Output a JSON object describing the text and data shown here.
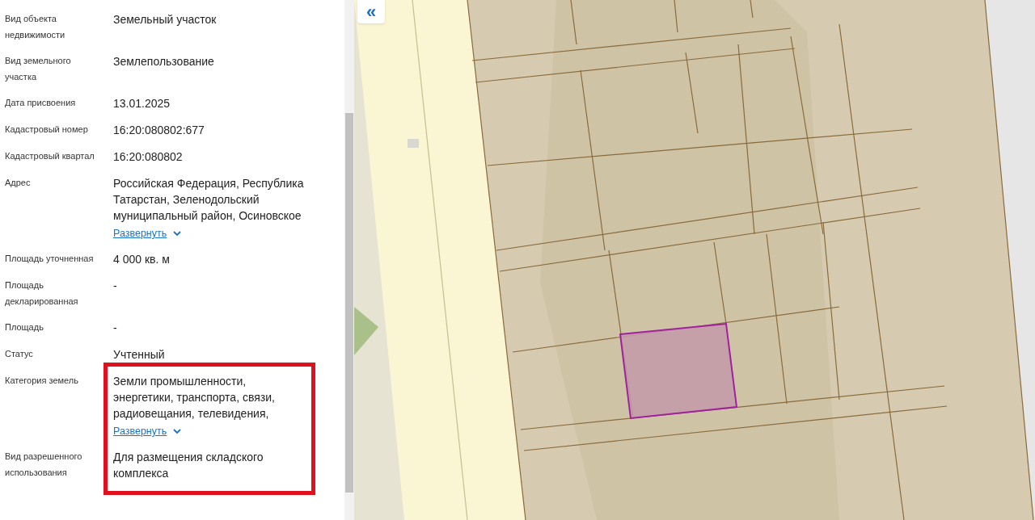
{
  "details": [
    {
      "label": "Вид объекта недвижимости",
      "value": "Земельный участок",
      "highlighted": false
    },
    {
      "label": "Вид земельного участка",
      "value": "Землепользование",
      "highlighted": false
    },
    {
      "label": "Дата присвоения",
      "value": "13.01.2025",
      "highlighted": false
    },
    {
      "label": "Кадастровый номер",
      "value": "16:20:080802:677",
      "highlighted": false
    },
    {
      "label": "Кадастровый квартал",
      "value": "16:20:080802",
      "highlighted": false
    },
    {
      "label": "Адрес",
      "value": "Российская Федерация, Республика Татарстан, Зеленодольский муниципальный район, Осиновское",
      "expand_link": "Развернуть",
      "highlighted": false
    },
    {
      "label": "Площадь уточненная",
      "value": "4 000 кв. м",
      "highlighted": false
    },
    {
      "label": "Площадь декларированная",
      "value": "-",
      "highlighted": false
    },
    {
      "label": "Площадь",
      "value": "-",
      "highlighted": false
    },
    {
      "label": "Статус",
      "value": "Учтенный",
      "highlighted": false
    },
    {
      "label": "Категория земель",
      "value": "Земли промышленности, энергетики, транспорта, связи, радиовещания, телевидения,",
      "expand_link": "Развернуть",
      "highlighted": true
    },
    {
      "label": "Вид разрешенного использования",
      "value": "Для размещения складского комплекса",
      "highlighted": true
    }
  ],
  "map": {
    "collapse_button": "«"
  }
}
